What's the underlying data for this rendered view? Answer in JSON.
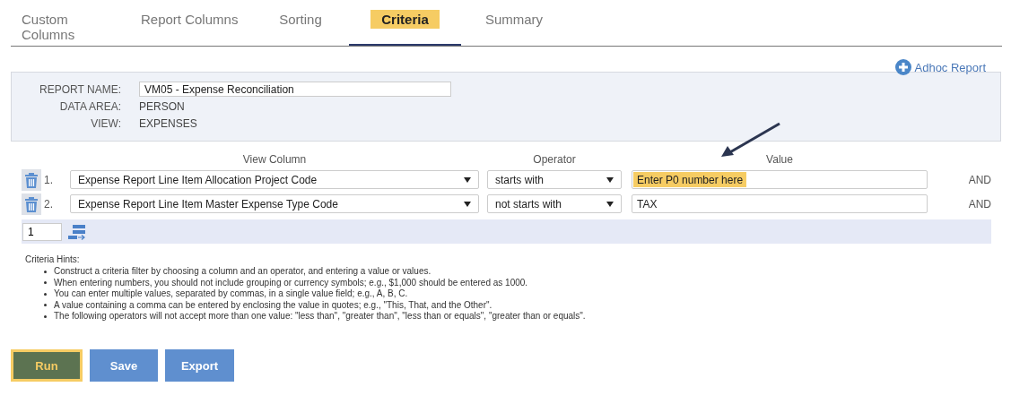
{
  "tabs": [
    {
      "label": "Custom Columns",
      "selected": false
    },
    {
      "label": "Report Columns",
      "selected": false
    },
    {
      "label": "Sorting",
      "selected": false
    },
    {
      "label": "Criteria",
      "selected": true
    },
    {
      "label": "Summary",
      "selected": false
    }
  ],
  "adhoc_link": "Adhoc Report",
  "report_info": [
    {
      "label": "REPORT NAME:",
      "value": "VM05 - Expense Reconciliation",
      "kind": "input"
    },
    {
      "label": "DATA AREA:",
      "value": "PERSON",
      "kind": "text"
    },
    {
      "label": "VIEW:",
      "value": "EXPENSES",
      "kind": "text"
    }
  ],
  "criteria": {
    "columns": [
      "View Column",
      "Operator",
      "Value"
    ],
    "rows": [
      {
        "number": "1.",
        "view_column": "Expense Report Line Item Allocation Project Code",
        "operator": "starts with",
        "value": "Enter P0 number here",
        "highlighted": true,
        "conjunction": "AND"
      },
      {
        "number": "2.",
        "view_column": "Expense Report Line Item Master Expense Type Code",
        "operator": "not starts with",
        "value": "TAX",
        "highlighted": false,
        "conjunction": "AND"
      }
    ],
    "add_count": "1"
  },
  "hints": {
    "title": "Criteria Hints:",
    "items": [
      "Construct a criteria filter by choosing a column and an operator, and entering a value or values.",
      "When entering numbers, you should not include grouping or currency symbols; e.g., $1,000 should be entered as 1000.",
      "You can enter multiple values, separated by commas, in a single value field; e.g., A, B, C.",
      "A value containing a comma can be entered by enclosing the value in quotes; e.g., \"This, That, and the Other\".",
      "The following operators will not accept more than one value: \"less than\", \"greater than\", \"less than or equals\", \"greater than or equals\"."
    ]
  },
  "buttons": [
    {
      "label": "Run",
      "kind": "primary",
      "highlighted": true
    },
    {
      "label": "Save",
      "kind": "secondary",
      "highlighted": false
    },
    {
      "label": "Export",
      "kind": "secondary",
      "highlighted": false
    }
  ]
}
